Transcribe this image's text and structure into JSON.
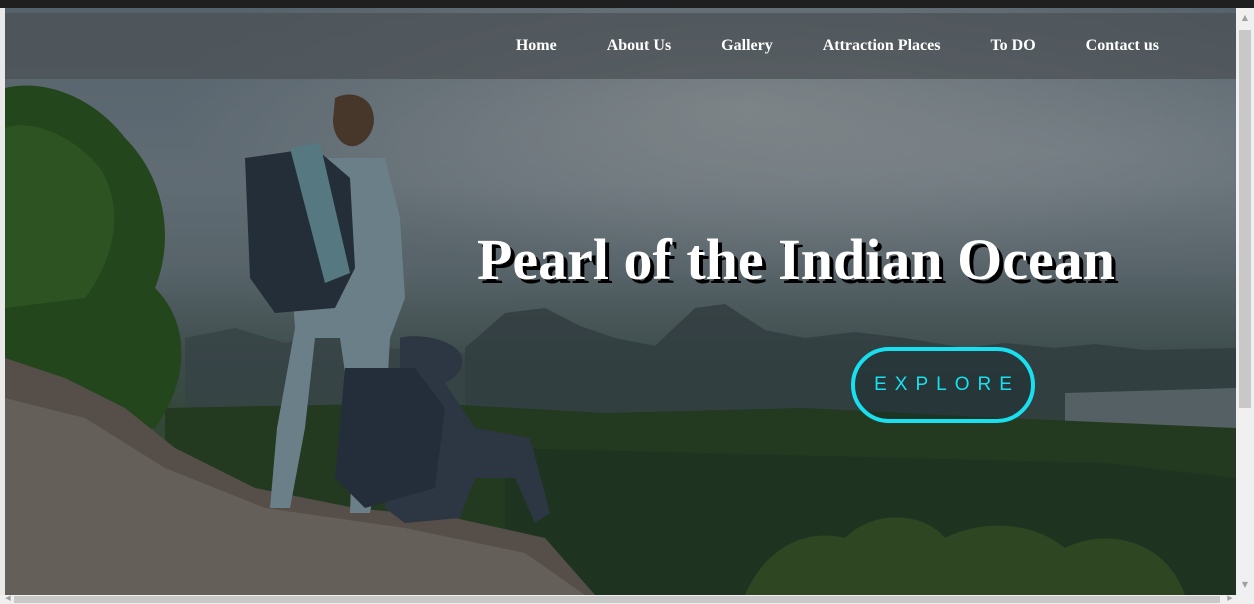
{
  "nav": {
    "items": [
      {
        "label": "Home"
      },
      {
        "label": "About Us"
      },
      {
        "label": "Gallery"
      },
      {
        "label": "Attraction Places"
      },
      {
        "label": "To DO"
      },
      {
        "label": "Contact us"
      }
    ]
  },
  "hero": {
    "title": "Pearl of the Indian Ocean",
    "button_label": "EXPLORE"
  },
  "colors": {
    "accent": "#19e0f0",
    "nav_text": "#ffffff",
    "title_text": "#ffffff"
  },
  "icons": {
    "scroll_up": "chevron-up-icon",
    "scroll_down": "chevron-down-icon",
    "scroll_left": "chevron-left-icon",
    "scroll_right": "chevron-right-icon"
  }
}
